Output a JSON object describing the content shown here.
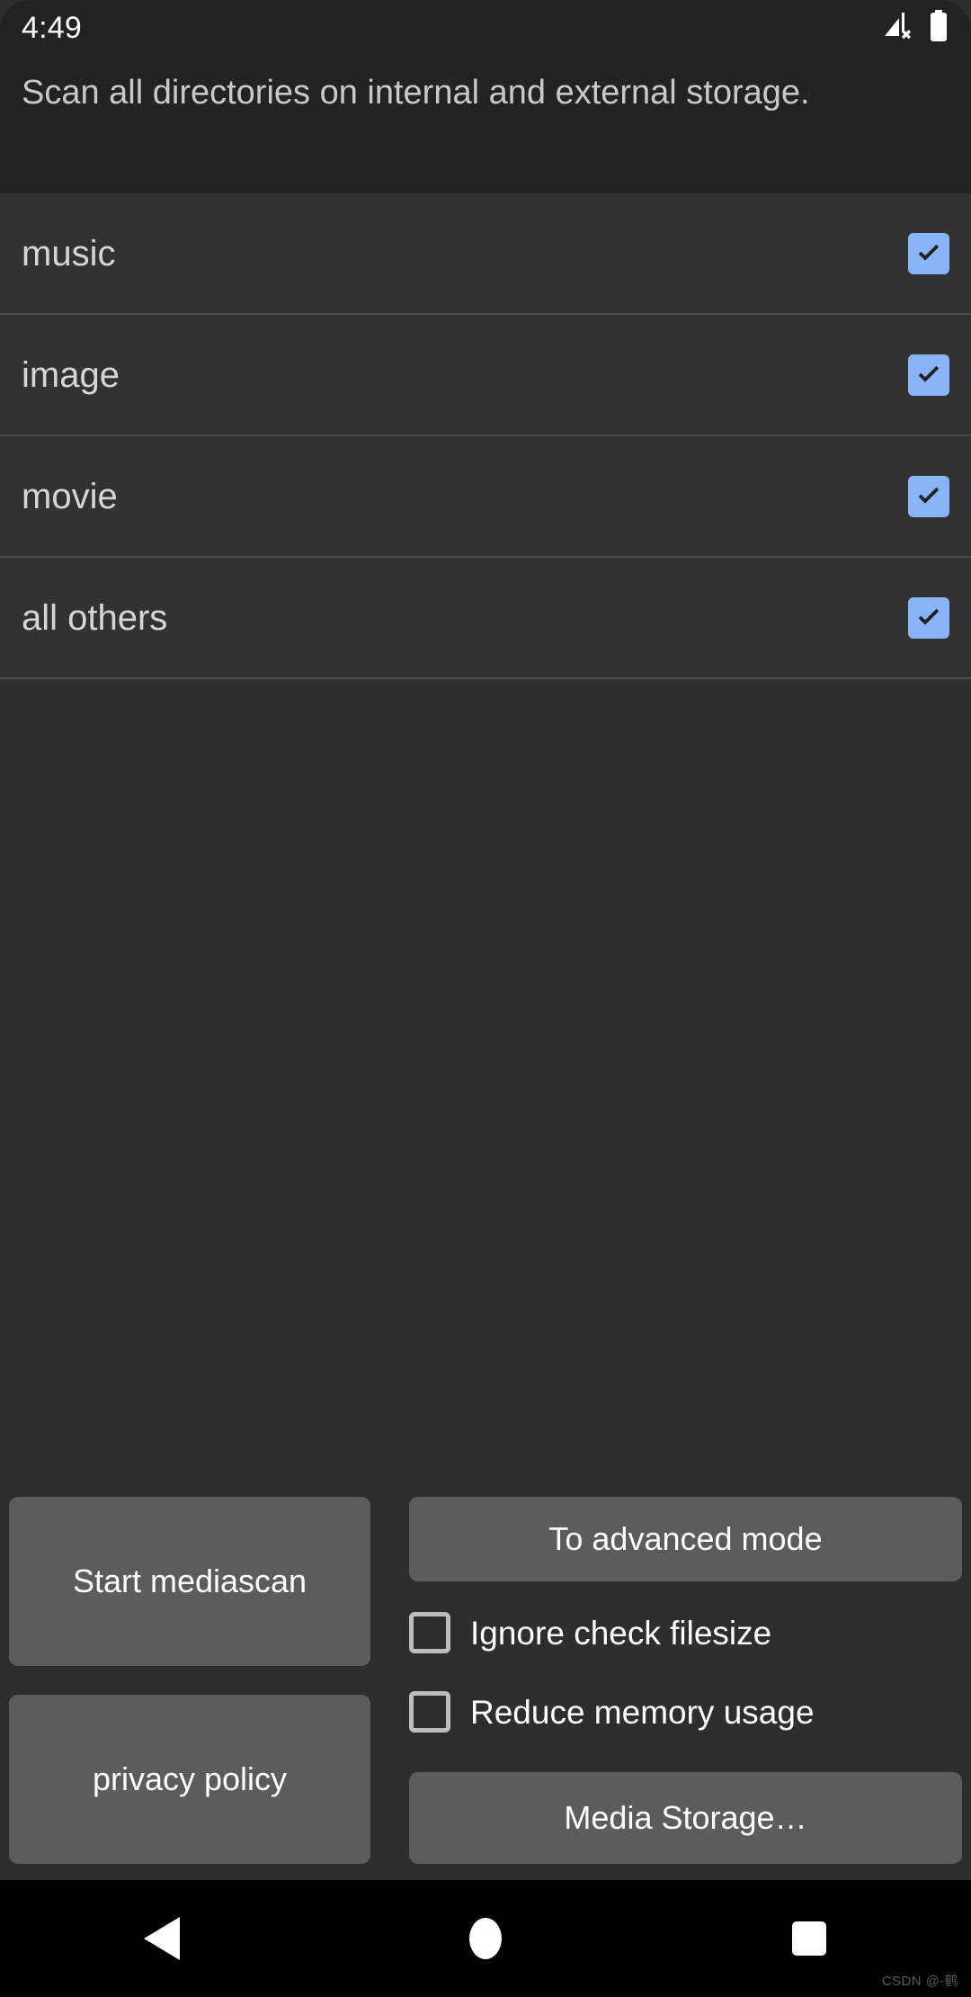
{
  "status_bar": {
    "clock": "4:49",
    "icons": [
      {
        "name": "cellular-no-service-icon",
        "glyph": "signal-x"
      },
      {
        "name": "battery-full-icon",
        "glyph": "battery"
      }
    ]
  },
  "header": {
    "description": "Scan all directories on internal and external storage."
  },
  "list": {
    "rows": [
      {
        "label": "music",
        "checked": true
      },
      {
        "label": "image",
        "checked": true
      },
      {
        "label": "movie",
        "checked": true
      },
      {
        "label": "all others",
        "checked": true
      }
    ]
  },
  "bottom": {
    "start_label": "Start mediascan",
    "privacy_label": "privacy policy",
    "advanced_label": "To advanced mode",
    "media_storage_label": "Media Storage…",
    "options": [
      {
        "label": "Ignore check filesize",
        "checked": false
      },
      {
        "label": "Reduce memory usage",
        "checked": false
      }
    ]
  },
  "nav_bar": {
    "back_label": "Back",
    "home_label": "Home",
    "recents_label": "Recents"
  },
  "watermark": "CSDN @-鹤",
  "colors": {
    "screen_background": "#2e2e2e",
    "header_background": "#232323",
    "list_background": "#323232",
    "divider": "#4b4b4b",
    "button_background": "#5c5c5c",
    "checkbox_accent": "#8ab4f8",
    "checkbox_outline": "#bdbdbd",
    "primary_text": "#ffffff",
    "secondary_text": "#c9c9c9",
    "nav_background": "#000000"
  }
}
